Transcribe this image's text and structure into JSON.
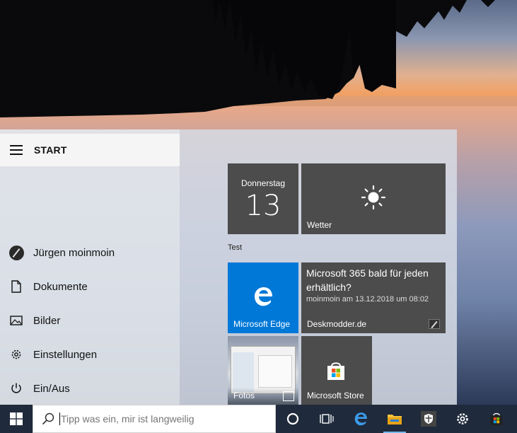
{
  "start_menu": {
    "title": "START",
    "nav": [
      {
        "label": "Jürgen moinmoin",
        "icon": "user-avatar-icon"
      },
      {
        "label": "Dokumente",
        "icon": "document-icon"
      },
      {
        "label": "Bilder",
        "icon": "pictures-icon"
      },
      {
        "label": "Einstellungen",
        "icon": "gear-icon"
      },
      {
        "label": "Ein/Aus",
        "icon": "power-icon"
      }
    ],
    "tiles": {
      "calendar": {
        "day": "Donnerstag",
        "date": "13"
      },
      "weather": {
        "label": "Wetter",
        "icon": "sun-icon"
      },
      "group_label": "Test",
      "edge": {
        "label": "Microsoft Edge",
        "icon": "edge-icon"
      },
      "news": {
        "title": "Microsoft 365 bald für jeden erhältlich?",
        "meta": "moinmoin am 13.12.2018 um 08:02",
        "source": "Deskmodder.de"
      },
      "photos": {
        "label": "Fotos"
      },
      "store": {
        "label": "Microsoft Store",
        "icon": "store-icon"
      }
    }
  },
  "taskbar": {
    "search_placeholder": "Tipp was ein, mir ist langweilig",
    "icons": [
      "cortana-icon",
      "task-view-icon",
      "edge-icon",
      "file-explorer-icon",
      "defender-icon",
      "settings-icon",
      "store-icon"
    ]
  },
  "colors": {
    "accent_blue": "#0078d7",
    "tile_dark": "#4c4c4c",
    "taskbar": "#1f2a3c"
  }
}
